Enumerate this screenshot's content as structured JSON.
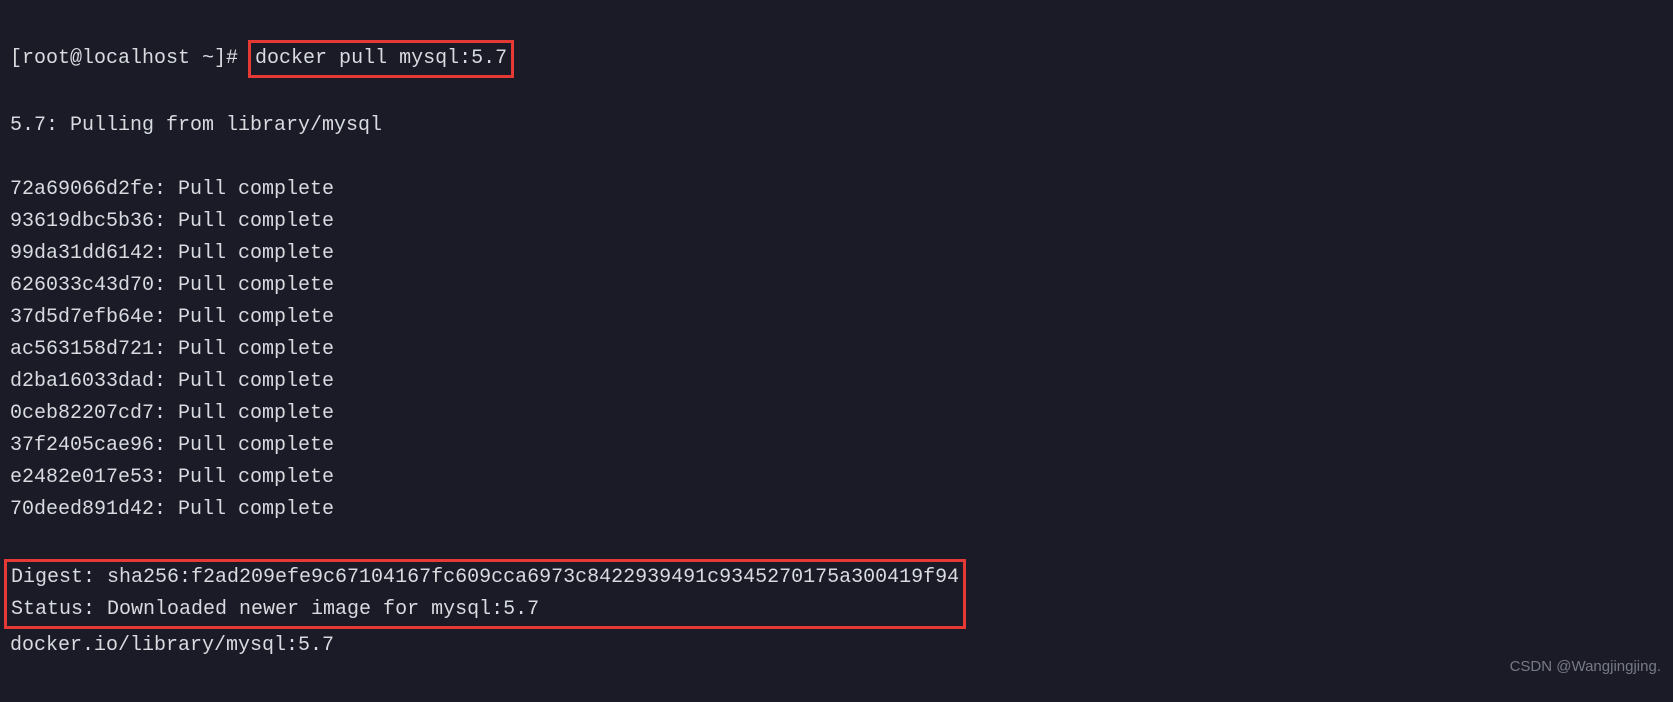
{
  "prompt": {
    "prefix": "[root@localhost ~]# ",
    "command": "docker pull mysql:5.7"
  },
  "pulling_header": "5.7: Pulling from library/mysql",
  "layers": [
    {
      "hash": "72a69066d2fe",
      "status": "Pull complete"
    },
    {
      "hash": "93619dbc5b36",
      "status": "Pull complete"
    },
    {
      "hash": "99da31dd6142",
      "status": "Pull complete"
    },
    {
      "hash": "626033c43d70",
      "status": "Pull complete"
    },
    {
      "hash": "37d5d7efb64e",
      "status": "Pull complete"
    },
    {
      "hash": "ac563158d721",
      "status": "Pull complete"
    },
    {
      "hash": "d2ba16033dad",
      "status": "Pull complete"
    },
    {
      "hash": "0ceb82207cd7",
      "status": "Pull complete"
    },
    {
      "hash": "37f2405cae96",
      "status": "Pull complete"
    },
    {
      "hash": "e2482e017e53",
      "status": "Pull complete"
    },
    {
      "hash": "70deed891d42",
      "status": "Pull complete"
    }
  ],
  "digest_line": "Digest: sha256:f2ad209efe9c67104167fc609cca6973c8422939491c9345270175a300419f94",
  "status_line": "Status: Downloaded newer image for mysql:5.7",
  "final_line": "docker.io/library/mysql:5.7",
  "watermark": "CSDN @Wangjingjing."
}
